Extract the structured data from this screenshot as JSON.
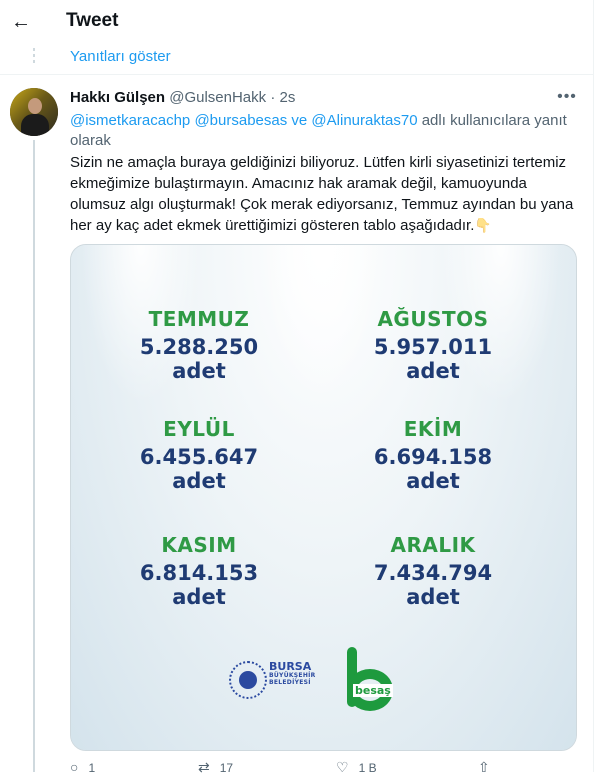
{
  "header": {
    "title": "Tweet",
    "back_icon": "←"
  },
  "thread": {
    "show_replies": "Yanıtları göster"
  },
  "tweet": {
    "author_name": "Hakkı Gülşen",
    "handle": "@GulsenHakk",
    "separator": "·",
    "time": "2s",
    "more_icon": "•••",
    "reply_to": {
      "mention_1": "@ismetkaracachp",
      "mention_2": "@bursabesas",
      "connector": "ve",
      "mention_3": "@Alinuraktas70",
      "suffix": "adlı kullanıcılara yanıt olarak"
    },
    "text": "Sizin ne amaçla buraya geldiğinizi biliyoruz. Lütfen kirli siyasetinizi tertemiz ekmeğimize bulaştırmayın. Amacınız hak aramak değil, kamuoyunda olumsuz algı oluşturmak! Çok merak ediyorsanız, Temmuz ayından bu yana her ay kaç adet ekmek ürettiğimizi gösteren tablo aşağıdadır.",
    "emoji": "👇",
    "media": {
      "months": [
        {
          "month": "TEMMUZ",
          "value": "5.288.250",
          "unit": "adet"
        },
        {
          "month": "AĞUSTOS",
          "value": "5.957.011",
          "unit": "adet"
        },
        {
          "month": "EYLÜL",
          "value": "6.455.647",
          "unit": "adet"
        },
        {
          "month": "EKİM",
          "value": "6.694.158",
          "unit": "adet"
        },
        {
          "month": "KASIM",
          "value": "6.814.153",
          "unit": "adet"
        },
        {
          "month": "ARALIK",
          "value": "7.434.794",
          "unit": "adet"
        }
      ],
      "logo_bursa_line1": "BURSA",
      "logo_bursa_line2": "BÜYÜKŞEHİR",
      "logo_bursa_line3": "BELEDİYESİ",
      "logo_besas": "besaş"
    },
    "actions": {
      "reply_count": "1",
      "retweet_count": "17",
      "like_count": "1 B"
    }
  }
}
